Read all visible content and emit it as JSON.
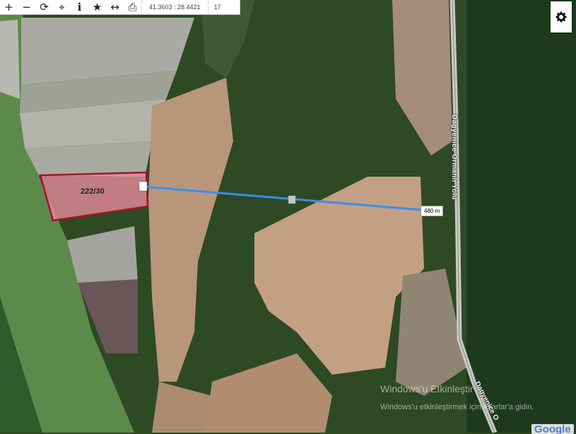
{
  "toolbar": {
    "buttons": [
      {
        "name": "zoom-in-button",
        "icon": "plus-icon",
        "glyph": "+"
      },
      {
        "name": "zoom-out-button",
        "icon": "minus-icon",
        "glyph": "−"
      },
      {
        "name": "refresh-button",
        "icon": "refresh-icon",
        "glyph": "⟳"
      },
      {
        "name": "locate-button",
        "icon": "crosshair-icon",
        "glyph": "⌖"
      },
      {
        "name": "info-button",
        "icon": "info-icon",
        "glyph": "i"
      },
      {
        "name": "favorite-button",
        "icon": "star-icon",
        "glyph": "★"
      },
      {
        "name": "measure-button",
        "icon": "arrows-horizontal-icon",
        "glyph": "↔"
      },
      {
        "name": "print-button",
        "icon": "printer-icon",
        "glyph": "⎙"
      }
    ],
    "coordinates": "41.3603 : 28.4421",
    "zoom": "17"
  },
  "map": {
    "parcel_label": "222/30",
    "distance_label": "480 m",
    "road_label": "Dagyenice Ormanlı Yolu",
    "road_label_2": "Dagyenice O",
    "colors": {
      "parcel_fill": "#e68a9a",
      "parcel_stroke": "#a3132a",
      "measure_line": "#3a8df0"
    }
  },
  "overlay": {
    "windows_line1": "Windows'u Etkinleştir",
    "windows_line2": "Windows'u etkinleştirmek için Ayarlar'a gidin.",
    "attribution": "Google"
  }
}
